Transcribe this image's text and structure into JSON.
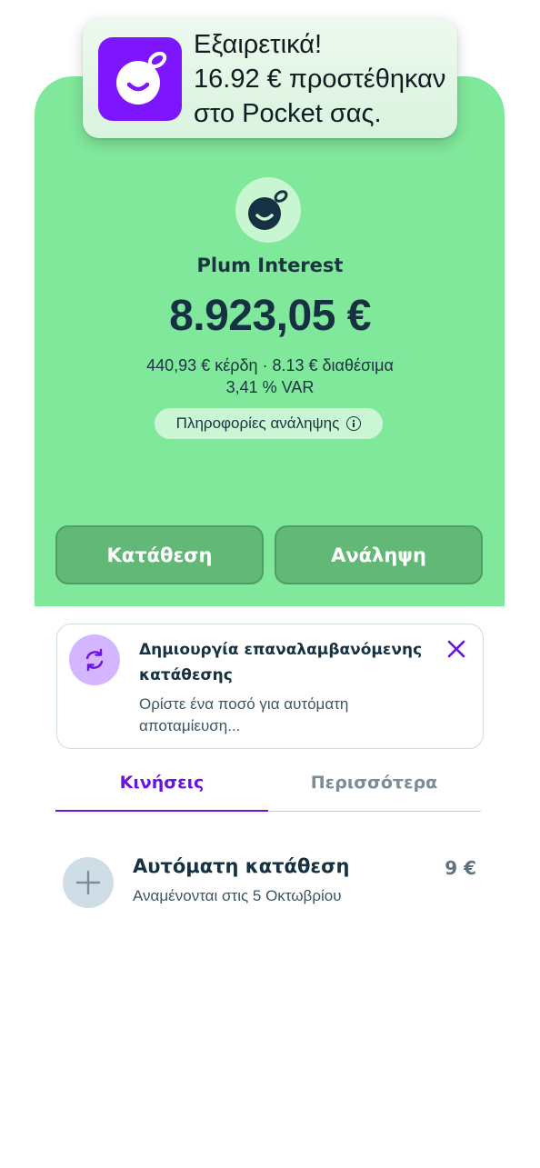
{
  "notification": {
    "line1": "Εξαιρετικά!",
    "line2": "16.92 € προστέθηκαν",
    "line3": "στο Pocket σας.",
    "logo_icon": "plum-logo-icon"
  },
  "pocket": {
    "name": "Plum Interest",
    "balance": "8.923,05 €",
    "earnings_line": "440,93 € κέρδη · 8.13 € διαθέσιμα",
    "rate_line": "3,41 % VAR",
    "withdraw_info_label": "Πληροφορίες ανάληψης"
  },
  "actions": {
    "deposit_label": "Κατάθεση",
    "withdraw_label": "Ανάληψη"
  },
  "promo_card": {
    "title": "Δημιουργία επαναλαμβανόμενης κατάθεσης",
    "description": "Ορίστε ένα ποσό για αυτόματη αποταμίευση..."
  },
  "tabs": [
    {
      "label": "Κινήσεις",
      "active": true
    },
    {
      "label": "Περισσότερα",
      "active": false
    }
  ],
  "transactions": [
    {
      "title": "Αυτόματη κατάθεση",
      "subtitle": "Αναμένονται στις 5 Οκτωβρίου",
      "amount": "9 €",
      "icon": "plus-icon"
    }
  ],
  "colors": {
    "hero_bg": "#80e89b",
    "accent": "#6a14e0",
    "brand_purple": "#7d16ff",
    "button_bg": "#62b977"
  }
}
